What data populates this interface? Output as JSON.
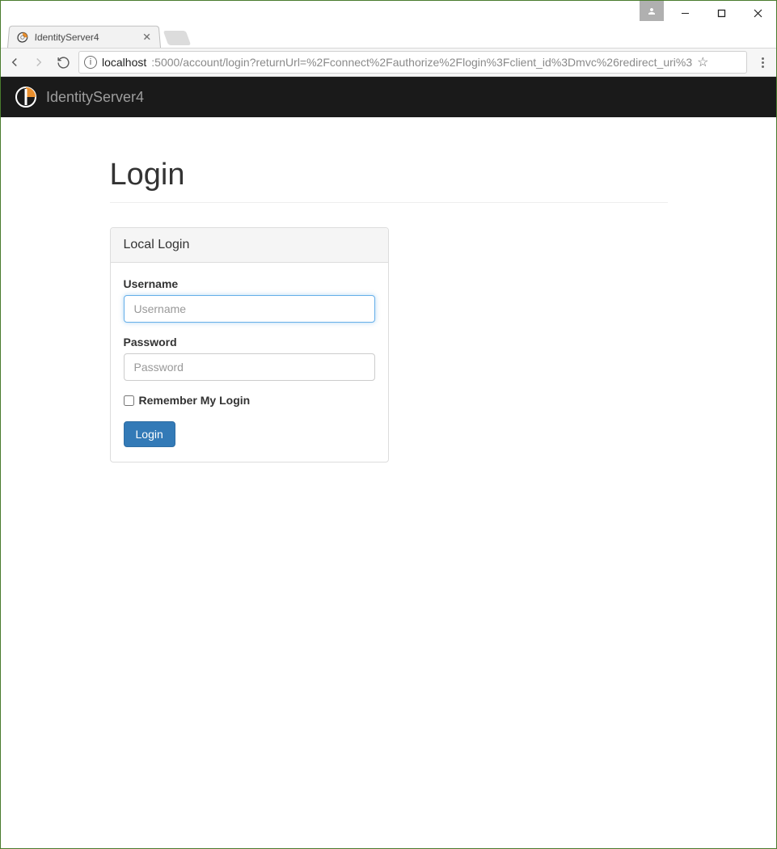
{
  "window": {
    "minimize": "–",
    "maximize": "☐",
    "close": "✕"
  },
  "browser": {
    "tab_title": "IdentityServer4",
    "url_host": "localhost",
    "url_rest": ":5000/account/login?returnUrl=%2Fconnect%2Fauthorize%2Flogin%3Fclient_id%3Dmvc%26redirect_uri%3"
  },
  "navbar": {
    "brand": "IdentityServer4"
  },
  "page": {
    "title": "Login",
    "panel_heading": "Local Login",
    "username_label": "Username",
    "username_placeholder": "Username",
    "password_label": "Password",
    "password_placeholder": "Password",
    "remember_label": "Remember My Login",
    "login_button": "Login"
  }
}
